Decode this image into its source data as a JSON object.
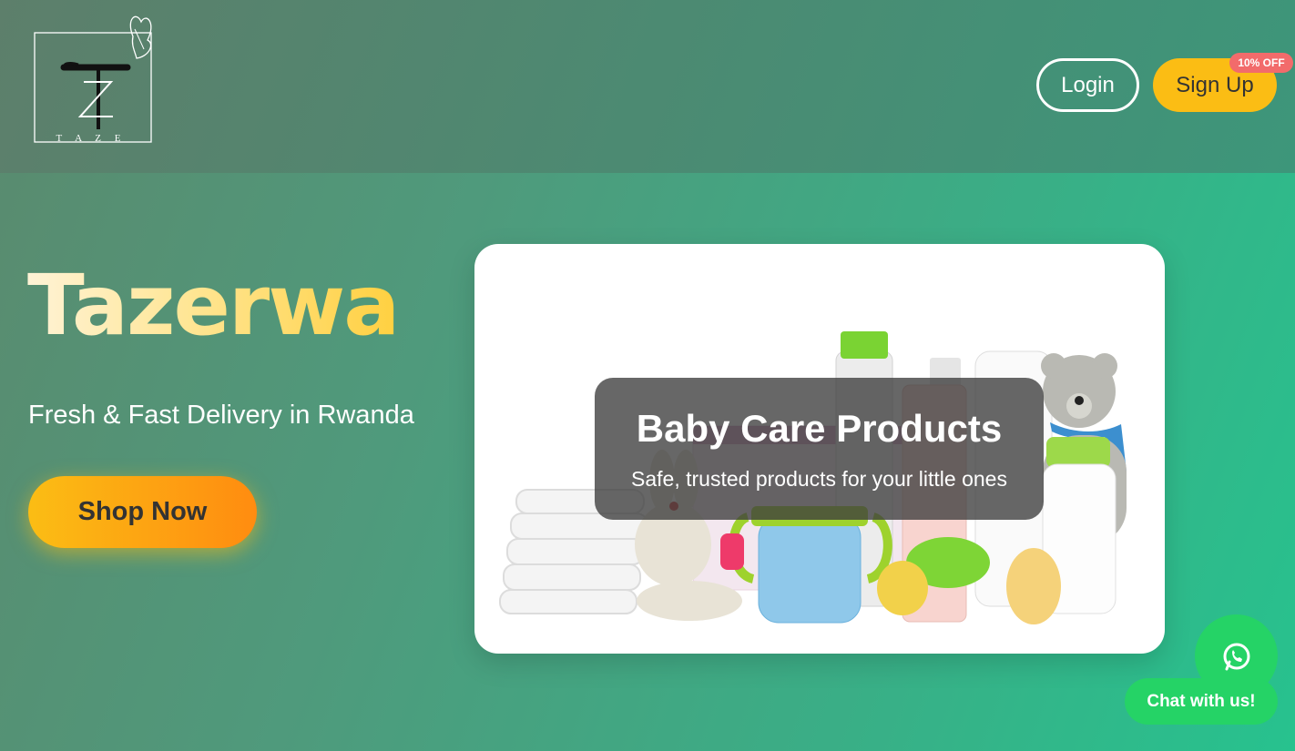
{
  "header": {
    "logo_text": "T A Z E",
    "login_label": "Login",
    "signup_label": "Sign Up",
    "signup_badge": "10% OFF"
  },
  "hero": {
    "title": "Tazerwa",
    "subtitle": "Fresh & Fast Delivery in Rwanda",
    "cta_label": "Shop Now"
  },
  "slide": {
    "title": "Baby Care Products",
    "description": "Safe, trusted products for your little ones"
  },
  "chat": {
    "icon": "whatsapp-icon",
    "label": "Chat with us!"
  },
  "colors": {
    "accent": "#fbbd14",
    "badge": "#f26b6b",
    "whatsapp": "#25d366"
  }
}
